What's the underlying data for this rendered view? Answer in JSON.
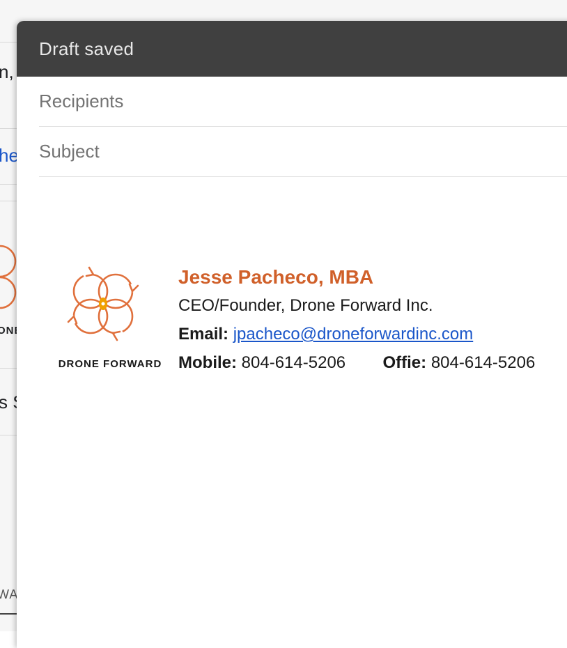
{
  "background": {
    "fragments": [
      "n, a",
      "he",
      "ONE",
      "s S",
      "WA"
    ]
  },
  "compose": {
    "status": "Draft saved",
    "recipients_placeholder": "Recipients",
    "subject_placeholder": "Subject"
  },
  "signature": {
    "logo_text": "DRONE FORWARD",
    "name": "Jesse Pacheco, MBA",
    "title": "CEO/Founder, Drone Forward Inc.",
    "email_label": "Email:",
    "email": "jpacheco@droneforwardinc.com",
    "mobile_label": "Mobile:",
    "mobile": "804-614-5206",
    "office_label": "Offie:",
    "office": "804-614-5206"
  },
  "colors": {
    "header_bg": "#404040",
    "name_accent": "#d0602a",
    "link": "#1a56c9",
    "logo_orange": "#e0703c",
    "logo_gold": "#f0a000"
  }
}
